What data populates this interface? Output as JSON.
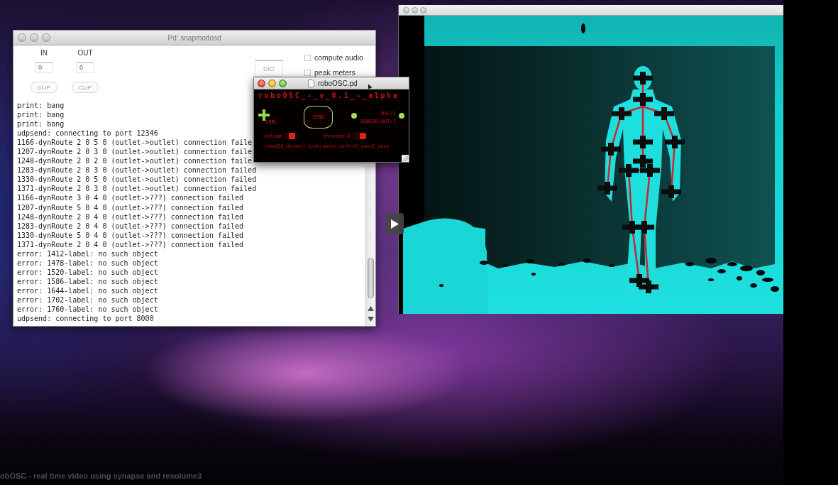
{
  "pd_window": {
    "active": false,
    "title": "Pd: snapmodosd",
    "channels": [
      {
        "label": "IN",
        "value": "0",
        "clip": "CLIP"
      },
      {
        "label": "OUT",
        "value": "0",
        "clip": "CLIP"
      }
    ],
    "dio_button": {
      "label": "DIO",
      "disabled": true
    },
    "options": [
      {
        "label": "compute audio",
        "checked": false
      },
      {
        "label": "peak meters",
        "checked": false
      }
    ],
    "console": [
      "print: bang",
      "print: bang",
      "print: bang",
      "udpsend: connecting to port 12346",
      "1166-dynRoute 2 0 5 0 (outlet->outlet) connection faile",
      "1207-dynRoute 2 0 3 0 (outlet->outlet) connection faile",
      "1248-dynRoute 2 0 2 0 (outlet->outlet) connection faile",
      "1283-dynRoute 2 0 3 0 (outlet->outlet) connection failed",
      "1330-dynRoute 2 0 5 0 (outlet->outlet) connection failed",
      "1371-dynRoute 2 0 3 0 (outlet->outlet) connection failed",
      "1166-dynRoute 3 0 4 0 (outlet->???) connection failed",
      "1207-dynRoute 5 0 4 0 (outlet->???) connection failed",
      "1248-dynRoute 2 0 4 0 (outlet->???) connection failed",
      "1283-dynRoute 2 0 4 0 (outlet->???) connection failed",
      "1330-dynRoute 5 0 4 0 (outlet->???) connection failed",
      "1371-dynRoute 2 0 4 0 (outlet->???) connection failed",
      "error: 1412-label: no such object",
      "error: 1478-label: no such object",
      "error: 1520-label: no such object",
      "error: 1586-label: no such object",
      "error: 1644-label: no such object",
      "error: 1702-label: no such object",
      "error: 1760-label: no such object",
      "udpsend: connecting to port 8000"
    ]
  },
  "patch_window": {
    "active": true,
    "title": "roboOSC.pd",
    "header": "roboOSC_-_v_0.1_-_alpha",
    "toggle_label": "ENBL",
    "bang_label": "SEND",
    "output_lines": [
      "OSC/1",
      "SENSOR/OUT/1"
    ],
    "sliders": [
      {
        "label": "volume",
        "level": 0.6
      },
      {
        "label": "threshold",
        "level": 0.85
      }
    ],
    "footer": "roboOSC_dynamic_instrument_control_panel_open"
  },
  "camera_window": {
    "active": false
  },
  "caption": "obOSC - real time video using synapse and resolume3"
}
